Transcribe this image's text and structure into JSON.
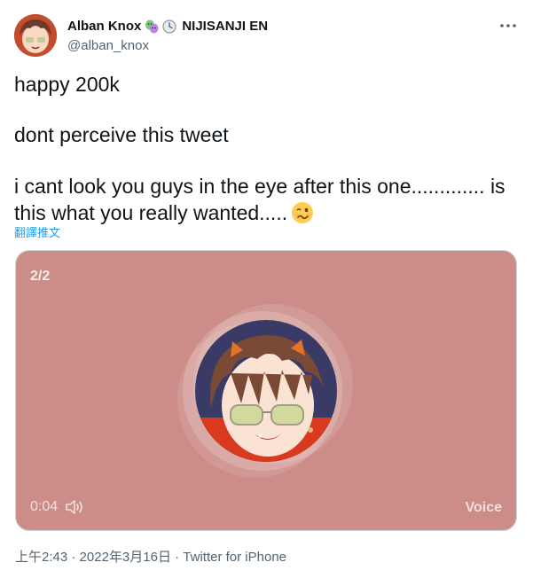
{
  "author": {
    "display_name": "Alban Knox",
    "affiliation": "NIJISANJI EN",
    "handle": "@alban_knox"
  },
  "more_icon": "more-horizontal-icon",
  "tweet": {
    "line1": "happy 200k",
    "line2": "dont perceive this tweet",
    "line3": "i cant look you guys in the eye after this one............. is this what you really wanted.....",
    "emoji": "woozy-face-emoji"
  },
  "translate_link": "翻譯推文",
  "media": {
    "counter": "2/2",
    "duration": "0:04",
    "label": "Voice",
    "background": "#cc8d88"
  },
  "meta": {
    "time": "上午2:43",
    "sep1": " · ",
    "date": "2022年3月16日",
    "sep2": " · ",
    "source": "Twitter for iPhone"
  },
  "colors": {
    "link": "#1d9bf0",
    "secondary_text": "#536471",
    "primary_text": "#0f1419"
  }
}
